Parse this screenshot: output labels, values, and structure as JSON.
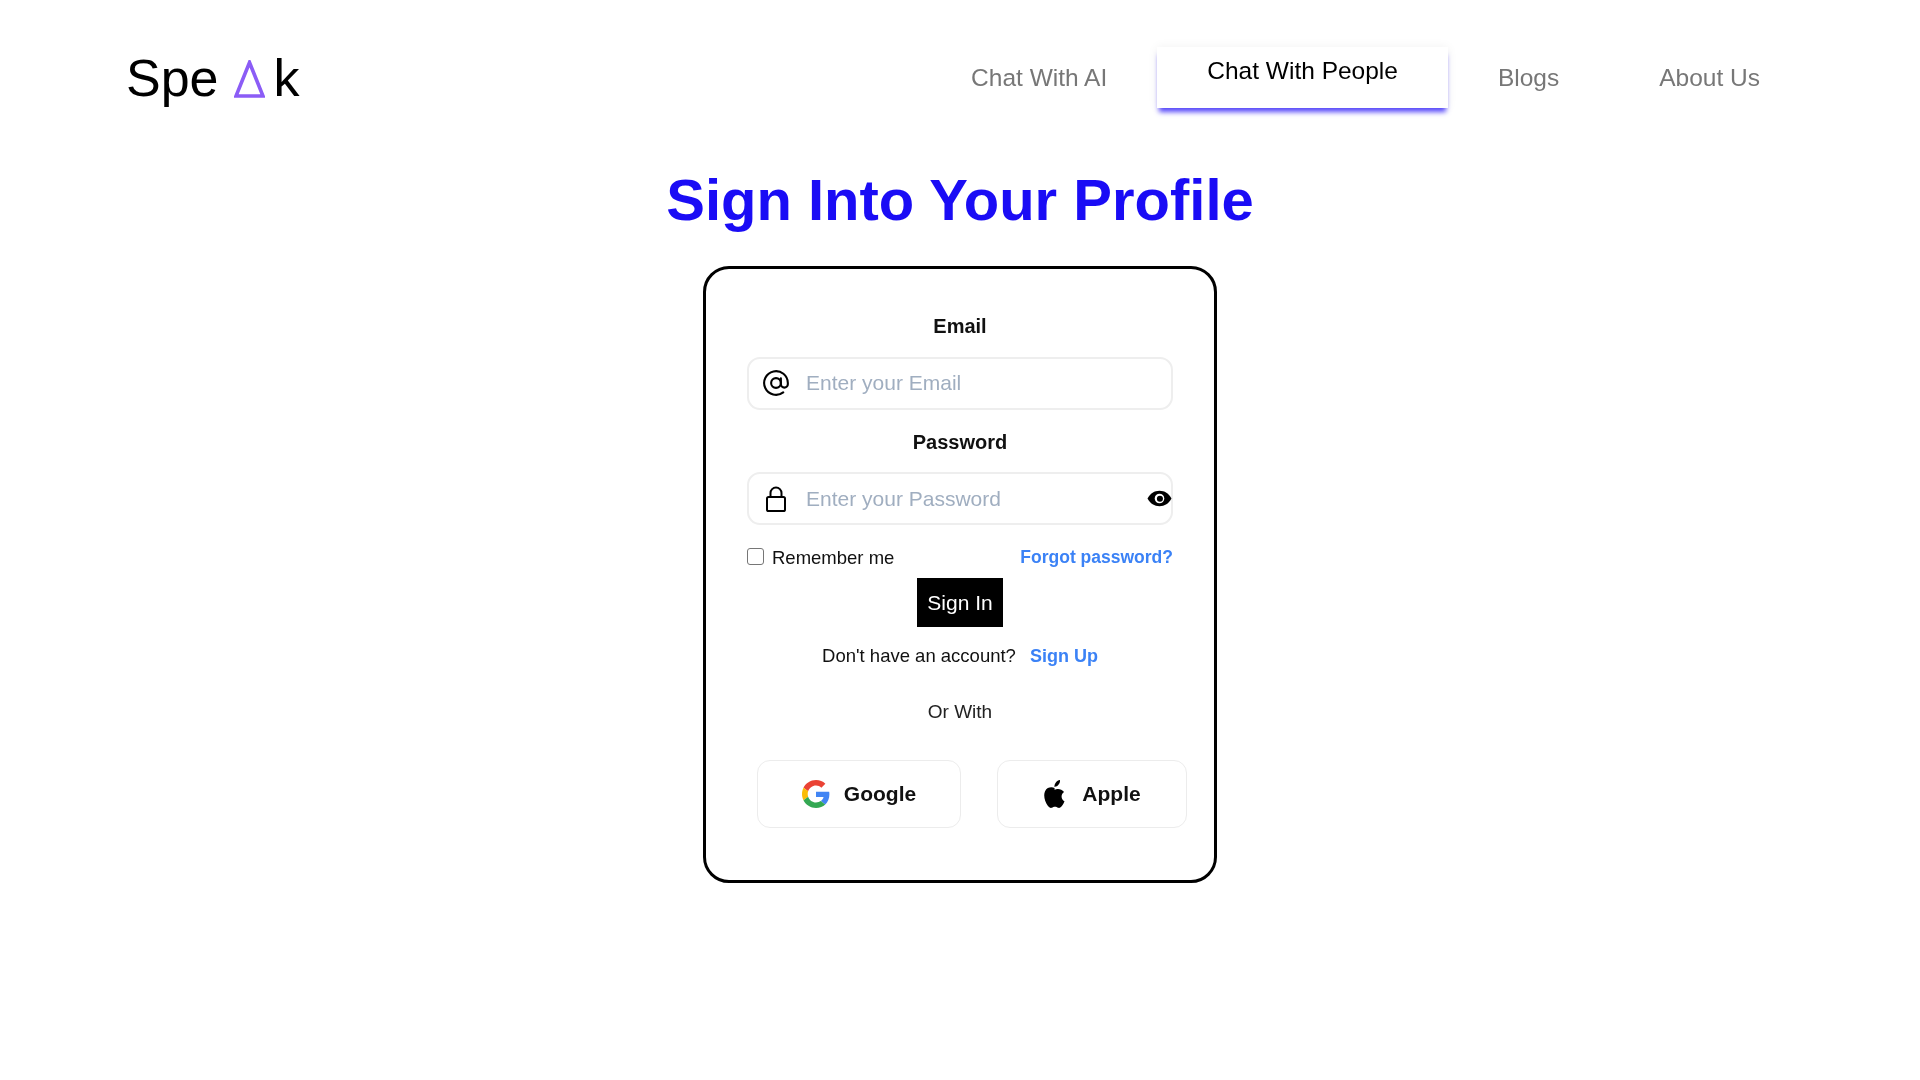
{
  "logo": {
    "text_before": "Spe",
    "text_after": "k"
  },
  "nav": [
    {
      "label": "Chat With AI",
      "selected": false
    },
    {
      "label": "Chat With People",
      "selected": true
    },
    {
      "label": "Blogs",
      "selected": false
    },
    {
      "label": "About Us",
      "selected": false
    }
  ],
  "title": "Sign Into Your Profile",
  "form": {
    "fields": [
      {
        "kind": "email",
        "label": "Email",
        "placeholder": "Enter your Email"
      },
      {
        "kind": "password",
        "label": "Password",
        "placeholder": "Enter your Password"
      }
    ],
    "remember_me": {
      "label": "Remember me",
      "checked": false
    },
    "forgot_link": "Forgot password?",
    "submit": "Sign In",
    "signup_prompt": "Don't have an account?",
    "signup_link": "Sign Up",
    "divider": "Or With",
    "social_buttons": [
      {
        "kind": "google",
        "label": "Google"
      },
      {
        "kind": "apple",
        "label": "Apple"
      }
    ]
  }
}
